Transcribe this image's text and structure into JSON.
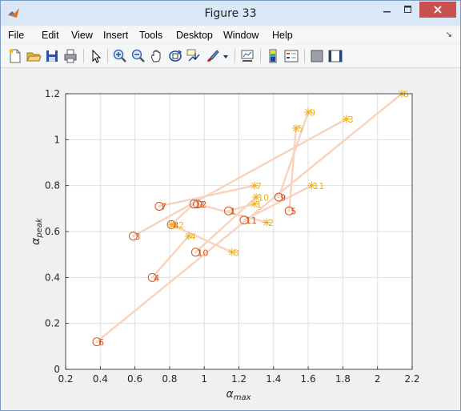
{
  "window": {
    "title": "Figure 33"
  },
  "menu": [
    "File",
    "Edit",
    "View",
    "Insert",
    "Tools",
    "Desktop",
    "Window",
    "Help"
  ],
  "toolbar": [
    {
      "name": "new-figure-icon"
    },
    {
      "name": "open-file-icon"
    },
    {
      "name": "save-icon"
    },
    {
      "name": "print-icon"
    },
    {
      "name": "edit-plot-arrow-icon"
    },
    {
      "name": "zoom-in-icon"
    },
    {
      "name": "zoom-out-icon"
    },
    {
      "name": "pan-hand-icon"
    },
    {
      "name": "rotate-3d-icon"
    },
    {
      "name": "data-cursor-icon"
    },
    {
      "name": "brush-icon"
    },
    {
      "name": "brush-dropdown-icon"
    },
    {
      "name": "link-plot-icon"
    },
    {
      "name": "insert-colorbar-icon"
    },
    {
      "name": "insert-legend-icon"
    },
    {
      "name": "hide-plot-tools-icon"
    },
    {
      "name": "show-plot-tools-icon"
    }
  ],
  "chart_data": {
    "type": "scatter",
    "xlabel": "α_max",
    "ylabel": "α_peak",
    "xlim": [
      0.2,
      2.2
    ],
    "ylim": [
      0,
      1.2
    ],
    "xticks": [
      "0.2",
      "0.4",
      "0.6",
      "0.8",
      "1",
      "1.2",
      "1.4",
      "1.6",
      "1.8",
      "2",
      "2.2"
    ],
    "yticks": [
      "0",
      "0.2",
      "0.4",
      "0.6",
      "0.8",
      "1",
      "1.2"
    ],
    "grid": true,
    "colors": {
      "circle": "#d95319",
      "star": "#edb120",
      "line": "#f7d3bd"
    },
    "pairs": [
      {
        "label": "1",
        "circle": [
          1.14,
          0.69
        ],
        "star": [
          1.29,
          0.72
        ]
      },
      {
        "label": "2",
        "circle": [
          0.96,
          0.72
        ],
        "star": [
          1.36,
          0.64
        ]
      },
      {
        "label": "3",
        "circle": [
          0.59,
          0.58
        ],
        "star": [
          1.82,
          1.09
        ]
      },
      {
        "label": "4",
        "circle": [
          0.7,
          0.4
        ],
        "star": [
          0.91,
          0.58
        ]
      },
      {
        "label": "5",
        "circle": [
          1.49,
          0.69
        ],
        "star": [
          1.53,
          1.05
        ]
      },
      {
        "label": "6",
        "circle": [
          0.38,
          0.12
        ],
        "star": [
          2.14,
          1.2
        ]
      },
      {
        "label": "7",
        "circle": [
          0.74,
          0.71
        ],
        "star": [
          1.29,
          0.8
        ]
      },
      {
        "label": "8",
        "circle": [
          0.81,
          0.63
        ],
        "star": [
          1.16,
          0.51
        ]
      },
      {
        "label": "9",
        "circle": [
          1.43,
          0.75
        ],
        "star": [
          1.6,
          1.12
        ]
      },
      {
        "label": "10",
        "circle": [
          0.95,
          0.51
        ],
        "star": [
          1.3,
          0.75
        ]
      },
      {
        "label": "11",
        "circle": [
          1.23,
          0.65
        ],
        "star": [
          1.62,
          0.8
        ]
      },
      {
        "label": "12",
        "circle": [
          0.94,
          0.72
        ],
        "star": [
          0.81,
          0.63
        ]
      }
    ]
  }
}
